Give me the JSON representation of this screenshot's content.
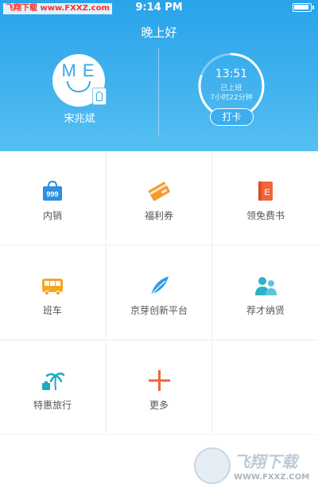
{
  "status_bar": {
    "watermark": "飞翔下载 www.FXXZ.com",
    "time": "9:14 PM"
  },
  "header": {
    "greeting": "晚上好",
    "avatar_letters": "ME",
    "user_name": "宋兆斌",
    "clock": {
      "time": "13:51",
      "status": "已上班",
      "duration": "7小时22分钟",
      "progress": 0.8
    },
    "punch_label": "打卡"
  },
  "grid": {
    "items": [
      {
        "label": "内销",
        "icon": "shopping-bag-icon",
        "color": "#2f8fe0"
      },
      {
        "label": "福利券",
        "icon": "coupon-card-icon",
        "color": "#f39a2e"
      },
      {
        "label": "领免费书",
        "icon": "book-icon",
        "color": "#f0653a"
      },
      {
        "label": "班车",
        "icon": "bus-icon",
        "color": "#f5a623"
      },
      {
        "label": "京芽创新平台",
        "icon": "sprout-leaf-icon",
        "color": "#2f9be6"
      },
      {
        "label": "荐才纳贤",
        "icon": "people-icon",
        "color": "#2eb0c9"
      },
      {
        "label": "特惠旅行",
        "icon": "palm-tree-icon",
        "color": "#22a8c4"
      },
      {
        "label": "更多",
        "icon": "plus-icon",
        "color": "#f0653a"
      }
    ]
  },
  "watermark": {
    "brand": "飞翔下载",
    "url": "WWW.FXXZ.COM"
  },
  "colors": {
    "header_top": "#29a3ea",
    "header_bottom": "#55c0f1",
    "grid_gap": "#f5f5f5"
  }
}
